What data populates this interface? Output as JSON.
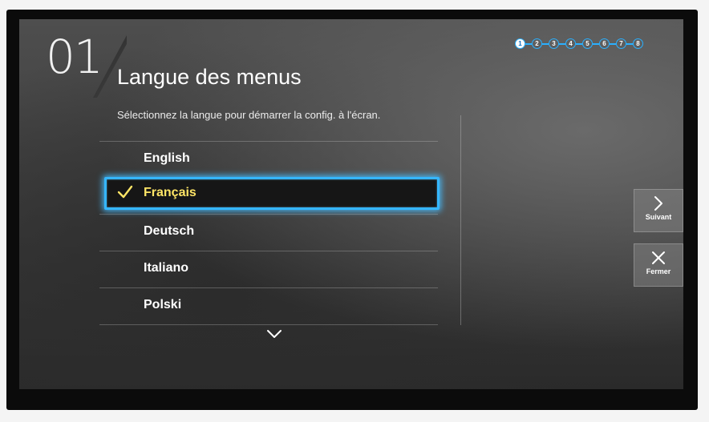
{
  "setup": {
    "step_number": "01",
    "title": "Langue des menus",
    "subtitle": "Sélectionnez la langue pour démarrer la config. à l'écran.",
    "progress": {
      "steps": [
        "1",
        "2",
        "3",
        "4",
        "5",
        "6",
        "7",
        "8"
      ],
      "current": 1,
      "accent_color": "#2ab0ff"
    }
  },
  "languages": {
    "items": [
      {
        "label": "English",
        "selected": false
      },
      {
        "label": "Français",
        "selected": true
      },
      {
        "label": "Deutsch",
        "selected": false
      },
      {
        "label": "Italiano",
        "selected": false
      },
      {
        "label": "Polski",
        "selected": false
      }
    ],
    "scroll_icon": "chevron-down-icon",
    "check_icon": "check-icon"
  },
  "nav": {
    "next_label": "Suivant",
    "next_icon": "chevron-right-icon",
    "close_label": "Fermer",
    "close_icon": "close-icon"
  },
  "colors": {
    "focus_border": "#35b6ff",
    "selected_text": "#ffe566"
  }
}
